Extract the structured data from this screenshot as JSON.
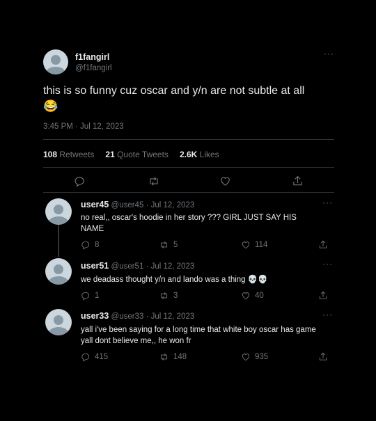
{
  "tweet": {
    "display_name": "f1fangirl",
    "handle": "@f1fangirl",
    "text": "this is so funny cuz oscar and y/n are not subtle at all",
    "emoji": "😂",
    "timestamp": "3:45 PM · Jul 12, 2023",
    "more_label": "···",
    "stats": {
      "retweets_num": "108",
      "retweets_label": "Retweets",
      "quotes_num": "21",
      "quotes_label": "Quote Tweets",
      "likes_num": "2.6K",
      "likes_label": "Likes"
    }
  },
  "replies": [
    {
      "name": "user45",
      "handle": "@user45",
      "sep": "·",
      "date": "Jul 12, 2023",
      "text": "no real,, oscar's hoodie in her story ??? GIRL JUST SAY HIS NAME",
      "replies": "8",
      "retweets": "5",
      "likes": "114",
      "more_label": "···"
    },
    {
      "name": "user51",
      "handle": "@user51",
      "sep": "·",
      "date": "Jul 12, 2023",
      "text": "we deadass thought y/n and lando was a thing 💀💀",
      "replies": "1",
      "retweets": "3",
      "likes": "40",
      "more_label": "···"
    },
    {
      "name": "user33",
      "handle": "@user33",
      "sep": "·",
      "date": "Jul 12, 2023",
      "text": "yall i've been saying for a long time that white boy oscar has game yall dont believe me,, he won fr",
      "replies": "415",
      "retweets": "148",
      "likes": "935",
      "more_label": "···"
    }
  ],
  "icons": {
    "reply": "reply-icon",
    "retweet": "retweet-icon",
    "like": "heart-icon",
    "share": "share-icon",
    "avatar": "avatar-placeholder",
    "more": "more-icon"
  },
  "colors": {
    "background": "#000000",
    "text": "#e7e9ea",
    "muted": "#71767b",
    "divider": "#2f3336",
    "avatar_bg": "#ccd6dd",
    "avatar_fg": "#8899a6"
  }
}
